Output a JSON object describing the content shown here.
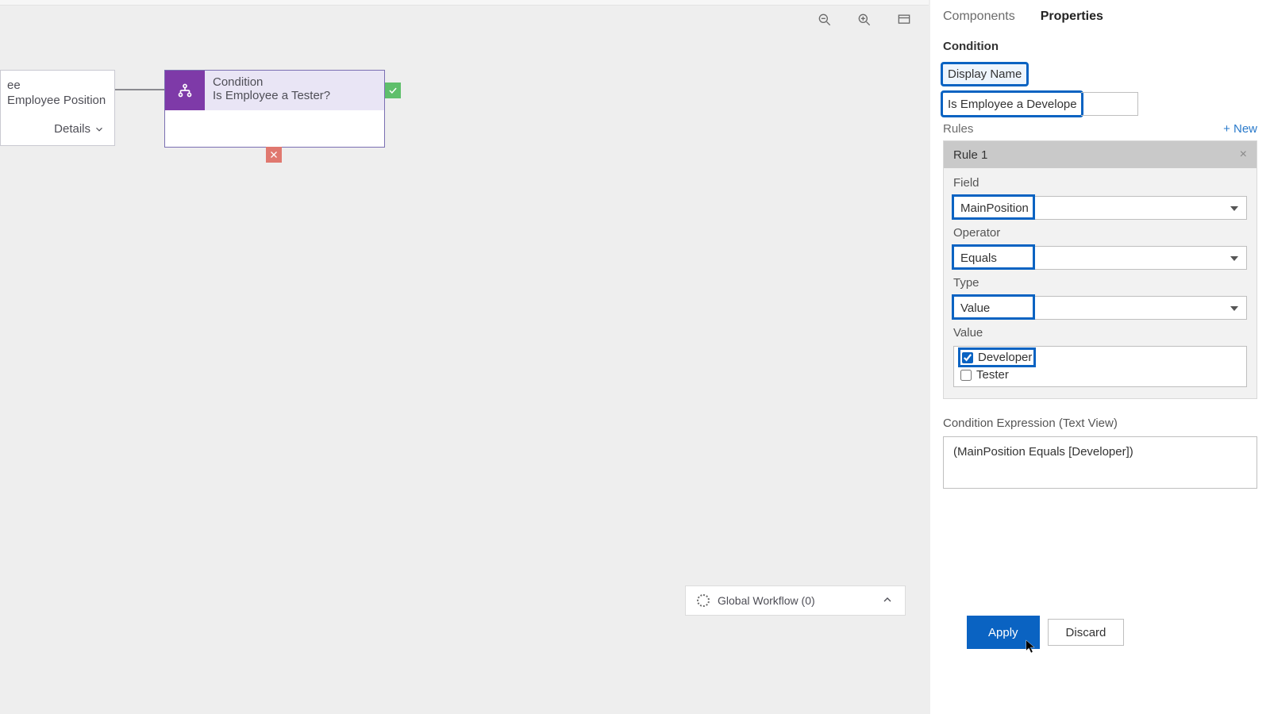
{
  "toolbar": {
    "zoom_out": "zoom-out",
    "zoom_in": "zoom-in",
    "fit": "fit-to-screen"
  },
  "canvas": {
    "left_node": {
      "line1": "ee",
      "line2": "Employee Position",
      "details_label": "Details"
    },
    "cond_node": {
      "type_label": "Condition",
      "name": "Is Employee a Tester?"
    }
  },
  "global": {
    "label": "Global Workflow (0)"
  },
  "tabs": {
    "components": "Components",
    "properties": "Properties"
  },
  "panel": {
    "heading": "Condition",
    "display_name_label": "Display Name",
    "display_name_value": "Is Employee a Developer?",
    "rules_label": "Rules",
    "new_label": "+ New",
    "rule_title": "Rule 1",
    "field_label": "Field",
    "field_value": "MainPosition",
    "operator_label": "Operator",
    "operator_value": "Equals",
    "type_label": "Type",
    "type_value": "Value",
    "value_label": "Value",
    "value_options": {
      "developer": "Developer",
      "tester": "Tester"
    },
    "expr_label": "Condition Expression (Text View)",
    "expr_value": "(MainPosition Equals [Developer])",
    "apply": "Apply",
    "discard": "Discard"
  }
}
